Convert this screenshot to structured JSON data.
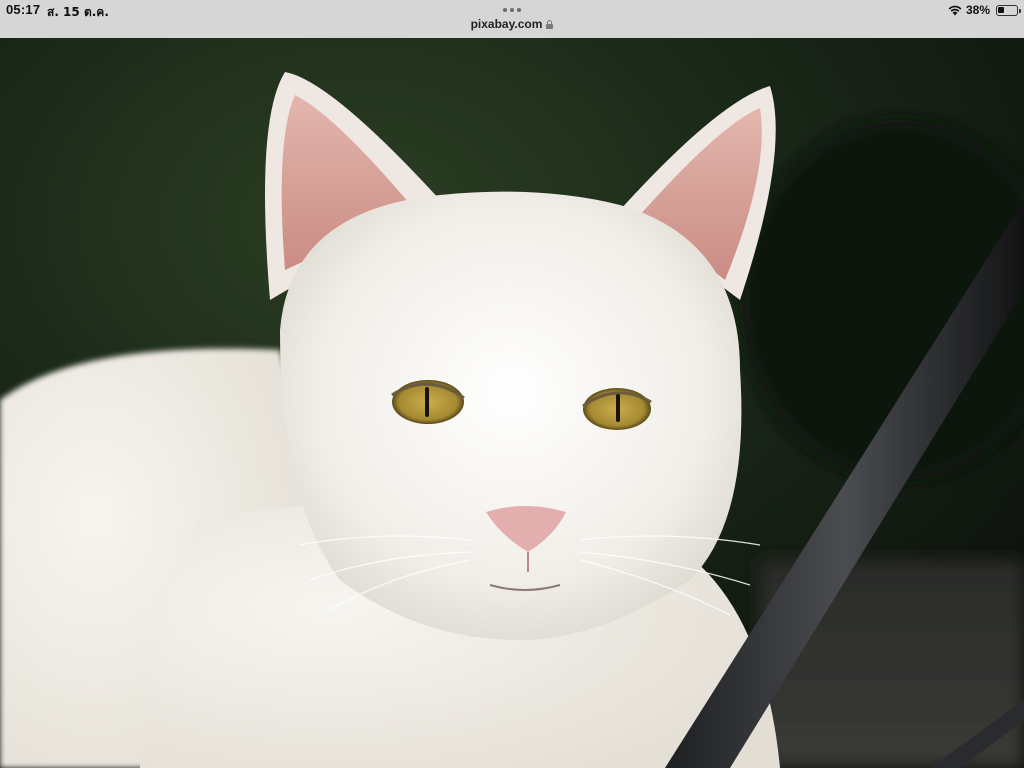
{
  "status_bar": {
    "time": "05:17",
    "date": "ส. 15 ต.ค.",
    "battery_percent_text": "38%",
    "battery_level": 0.38,
    "wifi_icon": "wifi-icon",
    "battery_icon": "battery-icon"
  },
  "browser": {
    "url": "pixabay.com",
    "secure_icon": "lock-icon",
    "more_icon": "more-dots-icon"
  },
  "photo": {
    "subject": "cat-photo"
  },
  "colors": {
    "status_bar_bg": "#d6d6d6",
    "cat_fur": "#f2efe9",
    "cat_eye": "#b59a3c",
    "background_dark": "#1a2a1a"
  }
}
